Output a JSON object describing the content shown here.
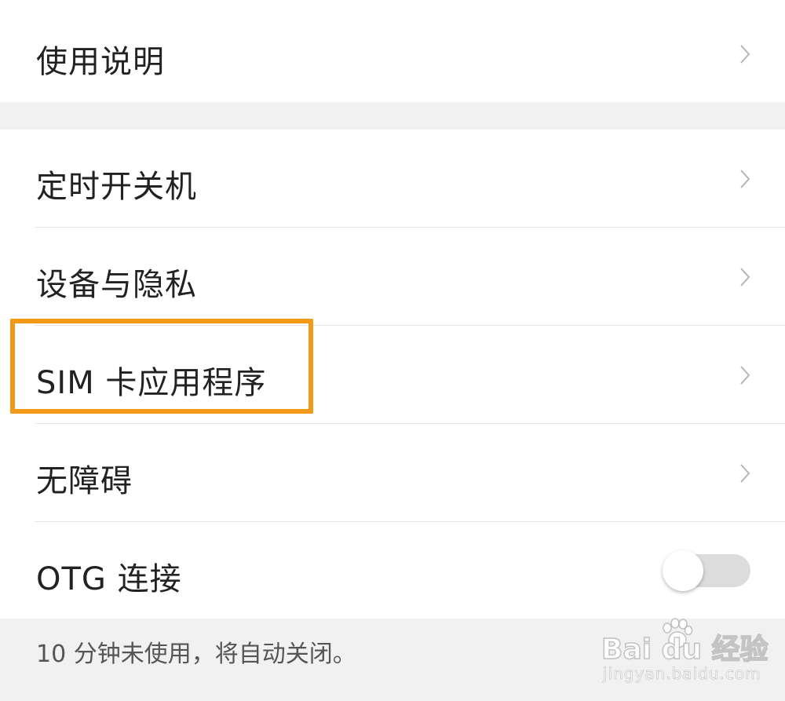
{
  "section1": {
    "items": [
      {
        "label": "使用说明",
        "icon": "chevron-right-icon"
      }
    ]
  },
  "section2": {
    "items": [
      {
        "label": "定时开关机",
        "icon": "chevron-right-icon"
      },
      {
        "label": "设备与隐私",
        "icon": "chevron-right-icon"
      },
      {
        "label": "SIM 卡应用程序",
        "icon": "chevron-right-icon",
        "highlighted": true
      },
      {
        "label": "无障碍",
        "icon": "chevron-right-icon"
      },
      {
        "label": "OTG 连接",
        "toggle": "off"
      }
    ]
  },
  "footer": {
    "note": "10 分钟未使用，将自动关闭。"
  },
  "watermark": {
    "main": "Bai du 经验",
    "sub": "jingyan.baidu.com"
  },
  "colors": {
    "highlight": "#f29a17",
    "background": "#f1f1f1",
    "card": "#ffffff",
    "text": "#222222",
    "toggle_track_off": "#dcdcdc"
  }
}
